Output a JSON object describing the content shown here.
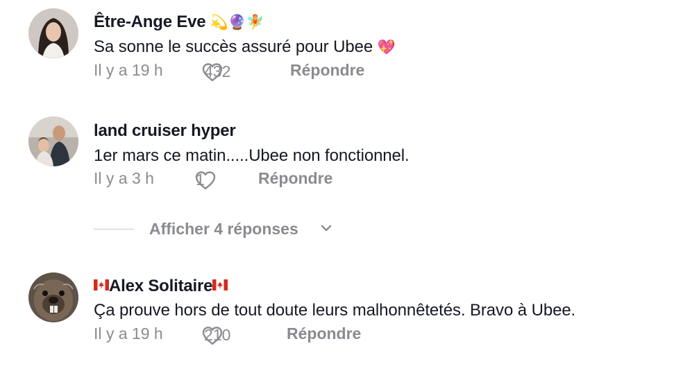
{
  "comments": [
    {
      "author": "Être-Ange Eve",
      "author_suffix_emoji": "💫🔮🧚",
      "text": "Sa sonne le succès assuré pour Ubee",
      "text_emoji": "💖",
      "time": "Il y a 19 h",
      "likes": "432",
      "reply_label": "Répondre"
    },
    {
      "author": "land cruiser hyper",
      "text": "1er mars ce matin.....Ubee non fonctionnel.",
      "time": "Il y a 3 h",
      "likes": "1",
      "reply_label": "Répondre",
      "view_replies_label": "Afficher 4 réponses"
    },
    {
      "author": "Alex Solitaire",
      "author_flag_icon": "canada-flag-icon",
      "text": "Ça prouve hors de tout doute leurs malhonnêtetés. Bravo à Ubee.",
      "time": "Il y a 19 h",
      "likes": "210",
      "reply_label": "Répondre"
    }
  ],
  "colors": {
    "primary_text": "#161823",
    "secondary_text": "#8a8b91",
    "divider": "#c7c8cc",
    "background": "#ffffff"
  }
}
